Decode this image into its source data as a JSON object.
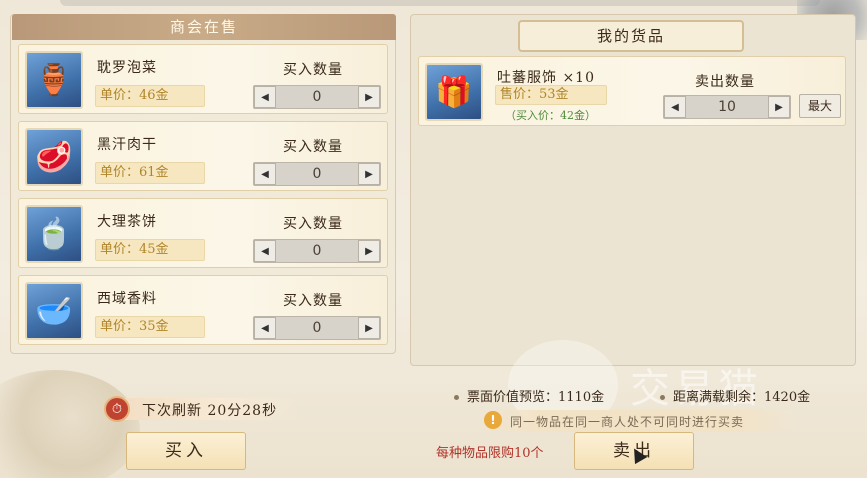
{
  "shop": {
    "title": "商会在售",
    "items": [
      {
        "name": "耽罗泡菜",
        "price": "单价：46金",
        "qty_label": "买入数量",
        "qty": "0",
        "icon": "kimchi-jar-icon"
      },
      {
        "name": "黑汗肉干",
        "price": "单价：61金",
        "qty_label": "买入数量",
        "qty": "0",
        "icon": "jerky-box-icon"
      },
      {
        "name": "大理茶饼",
        "price": "单价：45金",
        "qty_label": "买入数量",
        "qty": "0",
        "icon": "tea-cake-icon"
      },
      {
        "name": "西域香料",
        "price": "单价：35金",
        "qty_label": "买入数量",
        "qty": "0",
        "icon": "spice-bowl-icon"
      }
    ],
    "refresh": "下次刷新 20分28秒",
    "buy_button": "买入"
  },
  "my_goods": {
    "title": "我的货品",
    "items": [
      {
        "name": "吐蕃服饰 ×10",
        "price": "售价：53金",
        "buy_price": "（买入价：42金）",
        "qty_label": "卖出数量",
        "qty": "10",
        "max_label": "最大",
        "icon": "costume-chest-icon"
      }
    ],
    "face_value": "票面价值预览：1110金",
    "distance": "距离满载剩余：1420金",
    "warning": "同一物品在同一商人处不可同时进行买卖",
    "limit": "每种物品限购10个",
    "sell_button": "卖出"
  },
  "watermark": "交易猫",
  "colors": {
    "price": "#b0852a",
    "limit": "#b1342a",
    "buy_price": "#4f8a3b"
  }
}
